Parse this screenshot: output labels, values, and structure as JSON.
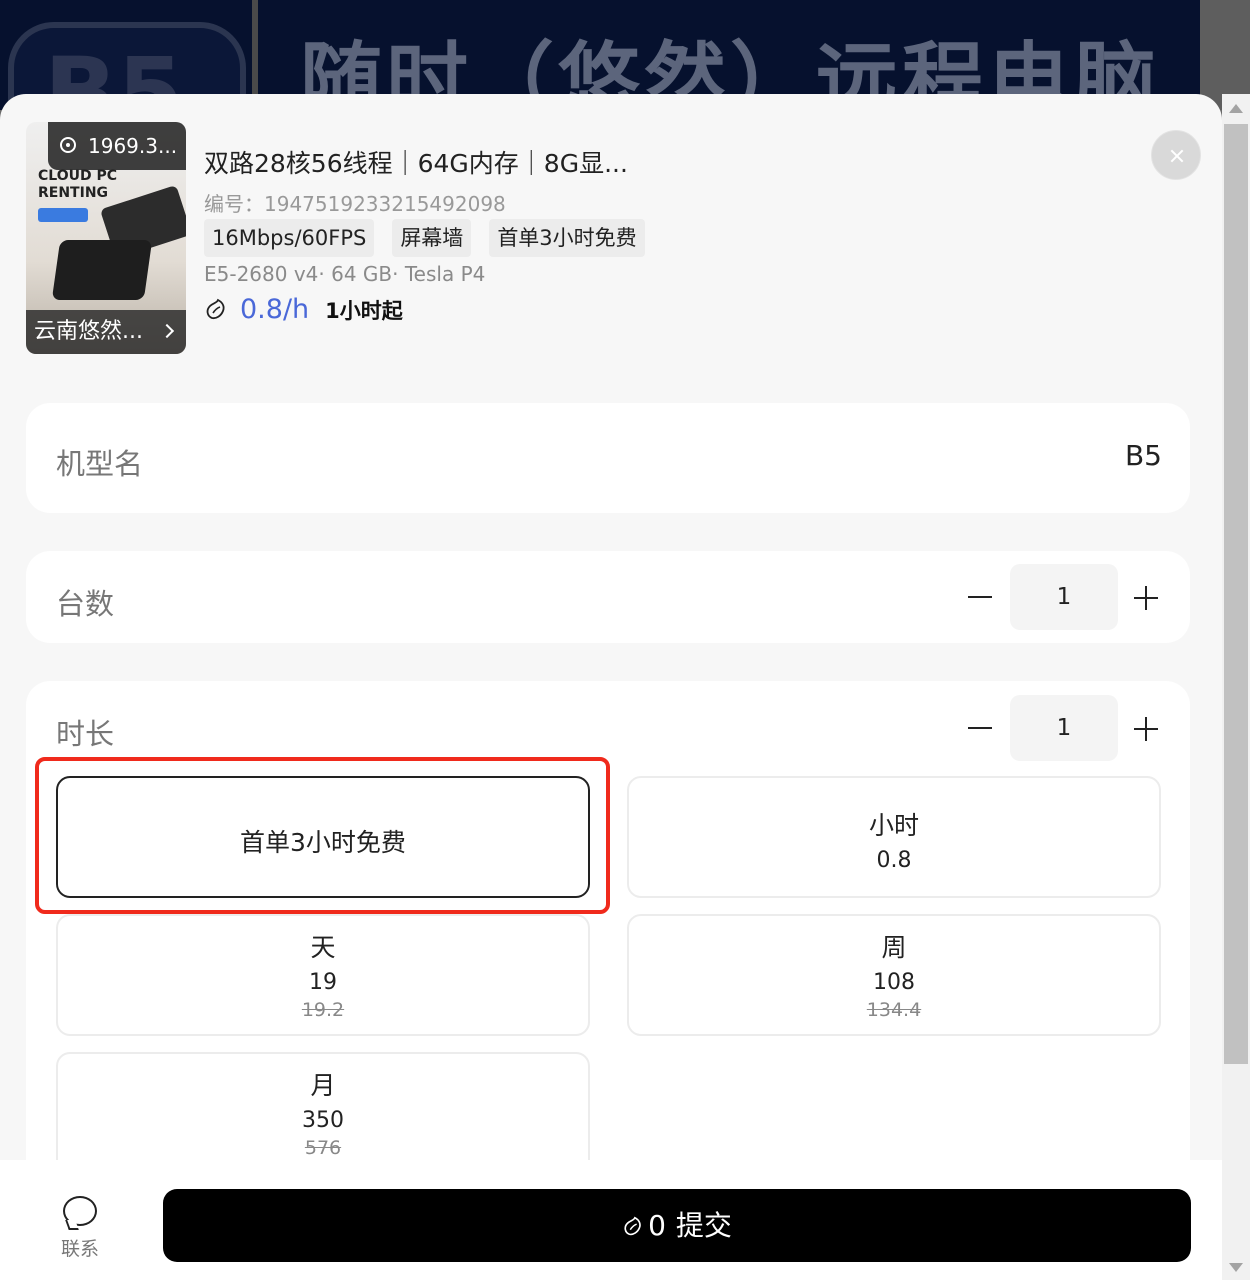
{
  "banner": {
    "logo": "B5",
    "text": "随时（悠然）远程电脑"
  },
  "product": {
    "location": "1969.3...",
    "thumb_brand": "CLOUD PC RENTING",
    "store": "云南悠然...",
    "title": "双路28核56线程｜64G内存｜8G显...",
    "id_label": "编号：",
    "id_value": "1947519233215492098",
    "tags": [
      "16Mbps/60FPS",
      "屏幕墙",
      "首单3小时免费"
    ],
    "spec": "E5-2680 v4· 64 GB· Tesla P4",
    "price": "0.8/h",
    "min_rent": "1小时起"
  },
  "model": {
    "label": "机型名",
    "value": "B5"
  },
  "quantity": {
    "label": "台数",
    "value": "1"
  },
  "duration": {
    "label": "时长",
    "value": "1",
    "options": [
      {
        "name": "首单3小时免费",
        "price": "",
        "original": ""
      },
      {
        "name": "小时",
        "price": "0.8",
        "original": ""
      },
      {
        "name": "天",
        "price": "19",
        "original": "19.2"
      },
      {
        "name": "周",
        "price": "108",
        "original": "134.4"
      },
      {
        "name": "月",
        "price": "350",
        "original": "576"
      }
    ]
  },
  "footer": {
    "contact_label": "联系",
    "submit_count": "0",
    "submit_label": "提交"
  },
  "colors": {
    "accent": "#4a68d8",
    "highlight": "#f02a1c",
    "primary_button": "#000000"
  }
}
